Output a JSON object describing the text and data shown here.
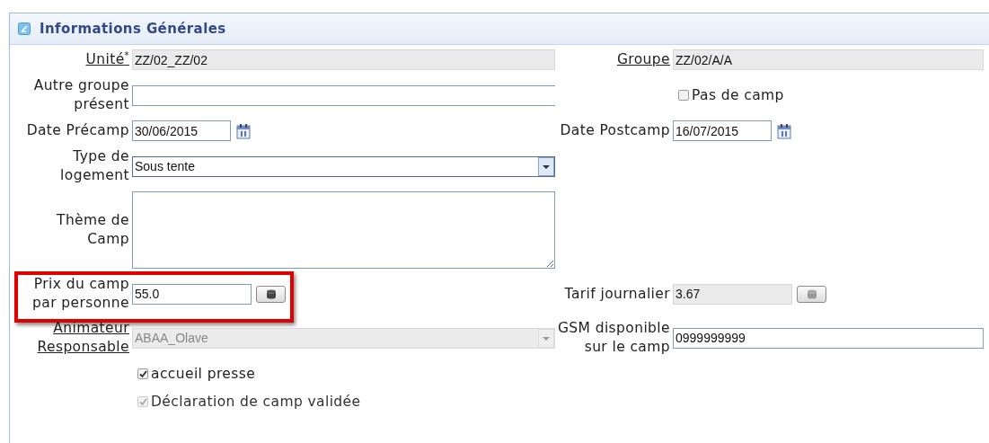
{
  "panel": {
    "title": "Informations Générales"
  },
  "rows": [
    {
      "left": {
        "kind": "text",
        "label": "Unité",
        "link": true,
        "marker": "*",
        "value": "ZZ/02_ZZ/02",
        "disabled": true
      },
      "right": {
        "kind": "text",
        "label": "Groupe",
        "link": true,
        "value": "ZZ/02/A/A",
        "disabled": true
      }
    },
    {
      "left": {
        "kind": "text",
        "label": "Autre groupe présent",
        "link": false,
        "disabled": false
      },
      "right": {
        "kind": "checkbox",
        "text": "Pas de camp",
        "checked": false,
        "disabled": false
      }
    },
    {
      "left": {
        "kind": "date",
        "label": "Date Précamp",
        "link": false,
        "value": "30/06/2015",
        "disabled": false
      },
      "right": {
        "kind": "date",
        "label": "Date Postcamp",
        "link": false,
        "value": "16/07/2015",
        "disabled": false
      }
    },
    {
      "left": {
        "kind": "select",
        "label": "Type de logement",
        "link": false,
        "value": "Sous tente",
        "disabled": false
      }
    },
    {
      "left": {
        "kind": "textarea",
        "label": "Thème de Camp",
        "link": false,
        "disabled": false
      }
    },
    {
      "left": {
        "kind": "number",
        "label": "Prix du camp par personne",
        "link": false,
        "value": "55.0",
        "disabled": false,
        "highlighted": true
      },
      "right": {
        "kind": "number",
        "label": "Tarif journalier",
        "link": false,
        "value": "3.67",
        "disabled": true
      }
    },
    {
      "left": {
        "kind": "select",
        "label": "Animateur Responsable",
        "link": true,
        "value": "ABAA_Olave",
        "disabled": true
      },
      "right": {
        "kind": "text",
        "label": "GSM disponible sur le camp",
        "link": false,
        "value": "0999999999",
        "disabled": false
      }
    },
    {
      "left": {
        "kind": "checkbox",
        "text": "accueil presse",
        "checked": true,
        "disabled": false
      }
    },
    {
      "left": {
        "kind": "checkbox",
        "text": "Déclaration de camp validée",
        "checked": true,
        "disabled": true
      }
    }
  ]
}
